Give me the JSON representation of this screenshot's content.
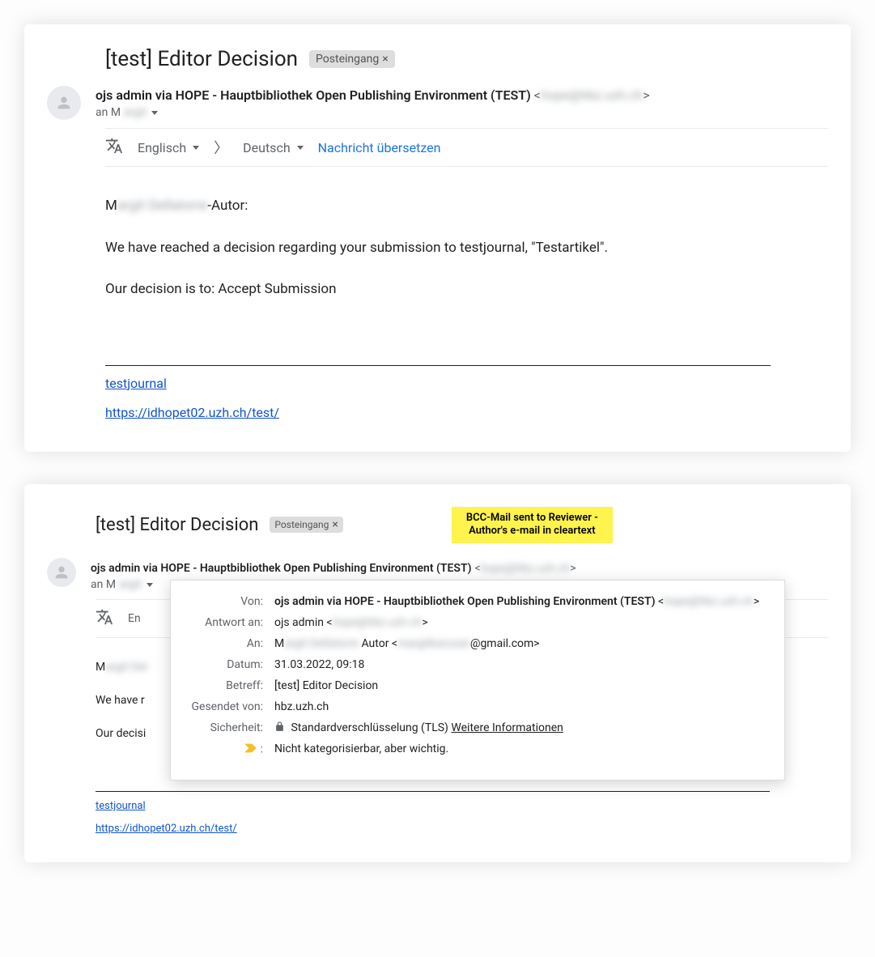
{
  "email1": {
    "subject": "[test] Editor Decision",
    "chip": "Posteingang",
    "sender_name": "ojs admin via HOPE - Hauptbibliothek Open Publishing Environment (TEST)",
    "sender_email_blurred": "hope@hbz.uzh.ch",
    "to_prefix": "an M",
    "to_blurred": "argit",
    "translate_from": "Englisch",
    "translate_to": "Deutsch",
    "translate_link": "Nachricht übersetzen",
    "body_line1_prefix": "M",
    "body_line1_blurred": "argit Dellatorre",
    "body_line1_suffix": "-Autor:",
    "body_line2": "We have reached a decision regarding your submission to testjournal, \"Testartikel\".",
    "body_line3": "Our decision is to: Accept Submission",
    "footer_link1_text": "testjournal",
    "footer_link2_text": "https://idhopet02.uzh.ch/test/"
  },
  "email2": {
    "subject": "[test] Editor Decision",
    "chip": "Posteingang",
    "highlight_line1": "BCC-Mail sent to Reviewer -",
    "highlight_line2": "Author's e-mail in cleartext",
    "sender_name": "ojs admin via HOPE - Hauptbibliothek Open Publishing Environment (TEST)",
    "sender_email_blurred": "hope@hbz.uzh.ch",
    "to_prefix": "an M",
    "to_blurred": "argit",
    "translate_from": "En",
    "body_line1_prefix": "M",
    "body_line1_blurred": "argit Del",
    "body_line2": "We have r",
    "body_line3": "Our decisi",
    "footer_link1_text": "testjournal",
    "footer_link2_text": "https://idhopet02.uzh.ch/test/",
    "details": {
      "von_label": "Von:",
      "von_name": "ojs admin via HOPE - Hauptbibliothek Open Publishing Environment (TEST)",
      "von_email_blurred": "hope@hbz.uzh.ch",
      "antwort_label": "Antwort an:",
      "antwort_value_prefix": "ojs admin <",
      "antwort_value_blurred": "hope@hbz.uzh.ch",
      "antwort_value_suffix": ">",
      "an_label": "An:",
      "an_value_prefix": "M",
      "an_value_blur1": "argit Dellatorre",
      "an_value_mid": " Autor <",
      "an_value_blur2": "margitkaruzan",
      "an_value_suffix": "@gmail.com>",
      "datum_label": "Datum:",
      "datum_value": "31.03.2022, 09:18",
      "betreff_label": "Betreff:",
      "betreff_value": "[test] Editor Decision",
      "gesendet_label": "Gesendet von:",
      "gesendet_value": "hbz.uzh.ch",
      "sicherheit_label": "Sicherheit:",
      "sicherheit_value": "Standardverschlüsselung (TLS)",
      "sicherheit_more": "Weitere Informationen",
      "important_symbol": ":",
      "important_text": "Nicht kategorisierbar, aber wichtig."
    }
  }
}
